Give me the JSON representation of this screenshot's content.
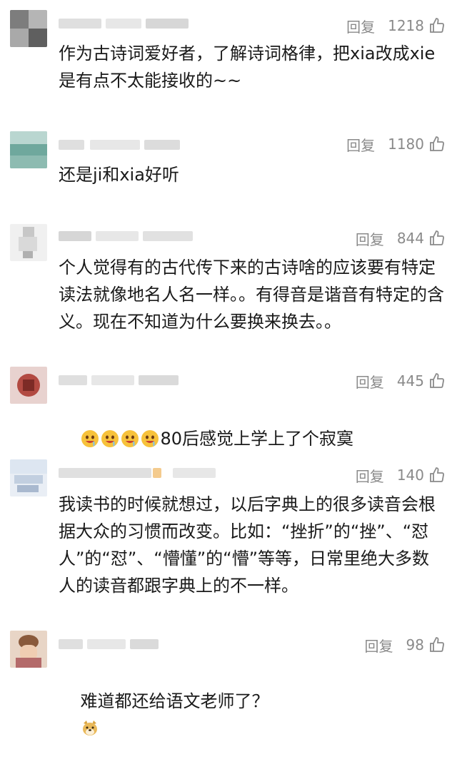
{
  "comments": [
    {
      "reply": "回复",
      "likes": "1218",
      "text": "作为古诗词爱好者，了解诗词格律，把xia改成xie是有点不太能接收的~~"
    },
    {
      "reply": "回复",
      "likes": "1180",
      "text": "还是ji和xia好听"
    },
    {
      "reply": "回复",
      "likes": "844",
      "text": "个人觉得有的古代传下来的古诗啥的应该要有特定读法就像地名人名一样。。有得音是谐音有特定的含义。现在不知道为什么要换来换去。。"
    },
    {
      "reply": "回复",
      "likes": "445",
      "text": "80后感觉上学上了个寂寞"
    },
    {
      "reply": "回复",
      "likes": "140",
      "text": "我读书的时候就想过，以后字典上的很多读音会根据大众的习惯而改变。比如：“挫折”的“挫”、“怼人”的“怼”、“懵懂”的“懵”等等，日常里绝大多数人的读音都跟字典上的不一样。"
    },
    {
      "reply": "回复",
      "likes": "98",
      "text": "难道都还给语文老师了？"
    }
  ],
  "icons": {
    "like": "thumbs-up-icon",
    "emoji_drool": "drooling-face-emoji",
    "emoji_doge": "doge-emoji"
  },
  "colors": {
    "muted": "#8a8a8a",
    "text": "#1a1a1a",
    "divider": "#ececec"
  }
}
